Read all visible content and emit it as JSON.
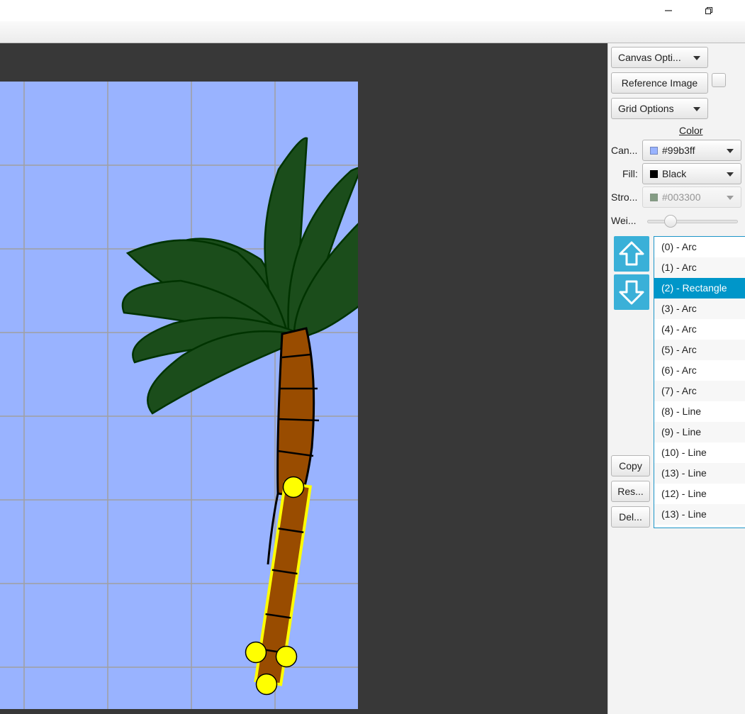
{
  "window": {
    "minimize_icon": "minimize-icon",
    "restore_icon": "restore-icon"
  },
  "canvas": {
    "background": "#99b3ff",
    "grid_color": "#a0a0a0",
    "selection_color": "#ffff00",
    "trunk_color": "#994c00",
    "frond_color": "#1b4d1b",
    "frond_stroke": "#003300"
  },
  "panel": {
    "canvas_options": "Canvas Opti...",
    "reference_image": "Reference Image",
    "grid_options": "Grid Options",
    "color_heading": "Color",
    "canvas_label": "Can...",
    "canvas_color": "#99b3ff",
    "fill_label": "Fill:",
    "fill_color_name": "Black",
    "fill_color": "#000000",
    "stroke_label": "Stro...",
    "stroke_color": "#003300",
    "weight_label": "Wei...",
    "weight_value": 0.22,
    "move_up_icon": "arrow-up-icon",
    "move_down_icon": "arrow-down-icon",
    "copy": "Copy",
    "reset": "Res...",
    "delete": "Del..."
  },
  "shapes": [
    "(0) - Arc",
    "(1) - Arc",
    "(2) - Rectangle",
    "(3) - Arc",
    "(4) - Arc",
    "(5) - Arc",
    "(6) - Arc",
    "(7) - Arc",
    "(8) - Line",
    "(9) - Line",
    "(10) - Line",
    "(13) - Line",
    "(12) - Line",
    "(13) - Line"
  ],
  "selected_shape_index": 2
}
